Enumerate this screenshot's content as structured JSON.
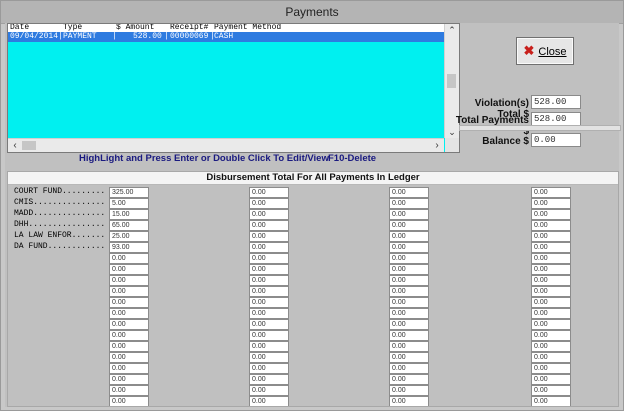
{
  "window": {
    "title": "Payments"
  },
  "list": {
    "headers": [
      "Date",
      "Type",
      "$ Amount",
      "Receipt#",
      "Payment Method"
    ],
    "rows": [
      {
        "date": "09/04/2014",
        "type": "PAYMENT",
        "amount": "528.00",
        "receipt": "00000069",
        "method": "CASH"
      }
    ]
  },
  "buttons": {
    "close_label": "Close"
  },
  "totals": {
    "violations_label": "Violation(s) Total $",
    "violations_value": "528.00",
    "payments_label": "Total Payments $",
    "payments_value": "528.00",
    "balance_label": "Balance $",
    "balance_value": "0.00"
  },
  "hints": {
    "edit": "HighLight and Press Enter or Double Click To Edit/View",
    "delete": "F10-Delete"
  },
  "disbursement": {
    "title": "Disbursement Total For All Payments In Ledger",
    "funds": [
      "COURT FUND.........",
      "CMIS...............",
      "MADD...............",
      "DHH................",
      "LA LAW ENFOR.......",
      "DA FUND............"
    ],
    "columns": [
      [
        "325.00",
        "5.00",
        "15.00",
        "65.00",
        "25.00",
        "93.00",
        "0.00",
        "0.00",
        "0.00",
        "0.00",
        "0.00",
        "0.00",
        "0.00",
        "0.00",
        "0.00",
        "0.00",
        "0.00",
        "0.00",
        "0.00",
        "0.00"
      ],
      [
        "0.00",
        "0.00",
        "0.00",
        "0.00",
        "0.00",
        "0.00",
        "0.00",
        "0.00",
        "0.00",
        "0.00",
        "0.00",
        "0.00",
        "0.00",
        "0.00",
        "0.00",
        "0.00",
        "0.00",
        "0.00",
        "0.00",
        "0.00"
      ],
      [
        "0.00",
        "0.00",
        "0.00",
        "0.00",
        "0.00",
        "0.00",
        "0.00",
        "0.00",
        "0.00",
        "0.00",
        "0.00",
        "0.00",
        "0.00",
        "0.00",
        "0.00",
        "0.00",
        "0.00",
        "0.00",
        "0.00",
        "0.00"
      ],
      [
        "0.00",
        "0.00",
        "0.00",
        "0.00",
        "0.00",
        "0.00",
        "0.00",
        "0.00",
        "0.00",
        "0.00",
        "0.00",
        "0.00",
        "0.00",
        "0.00",
        "0.00",
        "0.00",
        "0.00",
        "0.00",
        "0.00",
        "0.00"
      ]
    ]
  },
  "colors": {
    "list_background": "#00f0f0",
    "selected_row": "#2e7be0",
    "close_icon": "#c8201c",
    "hint_text": "#1a1a80"
  }
}
